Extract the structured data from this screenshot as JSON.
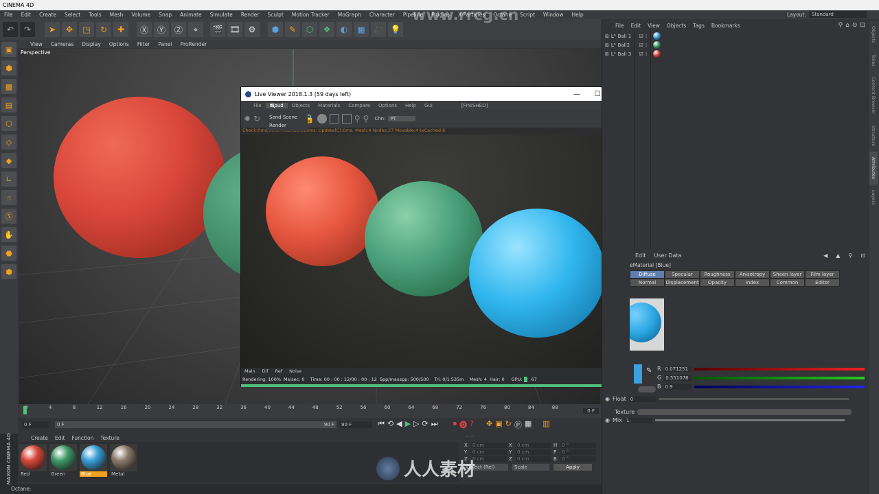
{
  "app": {
    "title": "CINEMA 4D"
  },
  "menu": [
    "File",
    "Edit",
    "Create",
    "Select",
    "Tools",
    "Mesh",
    "Volume",
    "Snap",
    "Animate",
    "Simulate",
    "Render",
    "Sculpt",
    "Motion Tracker",
    "MoGraph",
    "Character",
    "Pipeline",
    "Plugins",
    "X-Particles",
    "Octane",
    "Script",
    "Window",
    "Help"
  ],
  "layout": {
    "label": "Layout:",
    "value": "Standard"
  },
  "viewport": {
    "menu": [
      "View",
      "Cameras",
      "Display",
      "Options",
      "Filter",
      "Panel",
      "ProRender"
    ],
    "label": "Perspective"
  },
  "objects": {
    "menu": [
      "File",
      "Edit",
      "View",
      "Objects",
      "Tags",
      "Bookmarks"
    ],
    "items": [
      {
        "name": "Ball 1",
        "color": "#3a9fd8"
      },
      {
        "name": "Ball2",
        "color": "#3f9a6a"
      },
      {
        "name": "Ball 3",
        "color": "#d8463a"
      }
    ]
  },
  "live_viewer": {
    "title": "Live Viewer 2018.1.3 (59 days left)",
    "menu": [
      "File",
      "Cloud",
      "Objects",
      "Materials",
      "Compare",
      "Options",
      "Help",
      "Gui"
    ],
    "state": "[FINISHED]",
    "dropdown": [
      "Send Scene",
      "Render"
    ],
    "channel_label": "Chn:",
    "channel_value": "PT",
    "info": "Check:0ms/0ms. MeshGen:19ms. Update[C]:0ms. Mesh:4 Nodes:27 Movable:4 txCached:6",
    "tabs": [
      "Main",
      "Dif",
      "Ref",
      "Noise"
    ],
    "status": {
      "rendering": "Rendering: 100%",
      "mssec": "Ms/sec: 0",
      "time": "Time: 00 : 00 : 12/00 : 00 : 12",
      "spp": "Spp/maxspp: 500/500",
      "tri": "Tri: 0/1.535m",
      "mesh": "Mesh: 4",
      "hair": "Hair: 0",
      "gpu": "GPU:",
      "gpu_val": "67"
    }
  },
  "timeline": {
    "ticks": [
      "0",
      "4",
      "8",
      "12",
      "16",
      "20",
      "24",
      "28",
      "32",
      "36",
      "40",
      "44",
      "48",
      "52",
      "56",
      "60",
      "64",
      "68",
      "72",
      "76",
      "80",
      "84",
      "88"
    ],
    "end": "0 F",
    "start_field": "0 F",
    "min_field": "0 F",
    "max_field": "90 F",
    "end_field": "90 F"
  },
  "materials": {
    "menu": [
      "Create",
      "Edit",
      "Function",
      "Texture"
    ],
    "items": [
      {
        "name": "Red",
        "color": "#d8463a",
        "selected": false
      },
      {
        "name": "Green",
        "color": "#3f9a6a",
        "selected": false
      },
      {
        "name": "Blue",
        "color": "#3a9fd8",
        "selected": true
      },
      {
        "name": "Metal",
        "color": "#8a7a6a",
        "selected": false
      }
    ]
  },
  "coords": {
    "rows": [
      {
        "a": "X",
        "av": "0 cm",
        "b": "X",
        "bv": "0 cm",
        "c": "H",
        "cv": "0 °"
      },
      {
        "a": "Y",
        "av": "0 cm",
        "b": "Y",
        "bv": "0 cm",
        "c": "P",
        "cv": "0 °"
      },
      {
        "a": "Z",
        "av": "0 cm",
        "b": "Z",
        "bv": "0 cm",
        "c": "B",
        "cv": "0 °"
      }
    ],
    "mode": "Object (Rel)",
    "scale": "Scale",
    "apply": "Apply"
  },
  "status_text": "Octane:",
  "attributes": {
    "menu": [
      "Edit",
      "User Data"
    ],
    "title": "eMaterial [Blue]",
    "tabs_row1": [
      "Diffuse",
      "Specular",
      "Roughness",
      "Anisotropy",
      "Sheen layer",
      "Film layer"
    ],
    "tabs_row2": [
      "Normal",
      "Displacement",
      "Opacity",
      "Index",
      "Common",
      "Editor"
    ],
    "r_label": "R",
    "r_value": "0.071251",
    "g_label": "G",
    "g_value": "0.551076",
    "b_label": "B",
    "b_value": "0.9",
    "float_label": "Float",
    "float_value": "0",
    "texture_label": "Texture",
    "mix_label": "Mix",
    "mix_value": "1."
  },
  "right_tabs": [
    "Objects",
    "Takes",
    "Content Browser",
    "Structure",
    "Attributes",
    "Layers"
  ],
  "watermark": "www.rrcg.cn",
  "logo": "人人素材"
}
